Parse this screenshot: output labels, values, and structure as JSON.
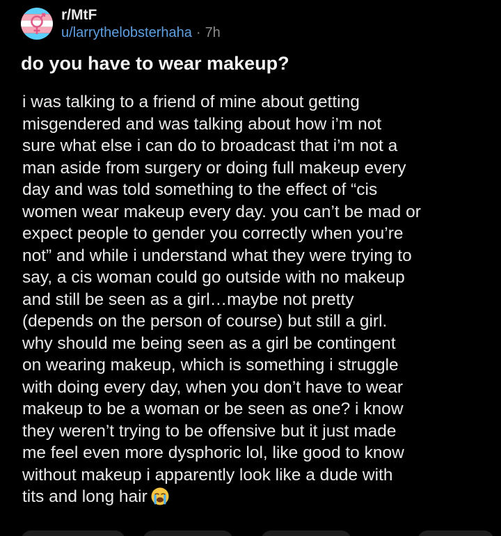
{
  "post": {
    "subreddit": "r/MtF",
    "username": "u/larrythelobsterhaha",
    "separator": "·",
    "age": "7h",
    "title": "do you have to wear makeup?",
    "body_lines": [
      "i was talking to a friend of mine about getting",
      "misgendered and was talking about how i’m not",
      "sure what else i can do to broadcast that i’m not a",
      "man aside from surgery or doing full makeup every",
      "day and was told something to the effect of “cis",
      "women wear makeup every day. you can’t be mad or",
      "expect people to gender you correctly when you’re",
      "not” and while i understand what they were trying to",
      "say, a cis woman could go outside with no makeup",
      "and still be seen as a girl…maybe not pretty",
      "(depends on the person of course) but still a girl.",
      "why should me being seen as a girl be contingent",
      "on wearing makeup, which is something i struggle",
      "with doing every day, when you don’t have to wear",
      "makeup to be a woman or be seen as one? i know",
      "they weren’t trying to be offensive but it just made",
      "me feel even more dysphoric lol, like good to know",
      "without makeup i apparently look like a dude with",
      "tits and long hair"
    ]
  },
  "icons": {
    "avatar": "transgender-flag-symbol-icon",
    "emoji": "loudly-crying-face-icon"
  },
  "colors": {
    "background": "#000000",
    "text": "#e9e9e9",
    "username": "#5f9fe0",
    "meta": "#8c8c8c",
    "flag_blue": "#5bcefa",
    "flag_pink": "#f5a9b8",
    "flag_white": "#ffffff"
  }
}
